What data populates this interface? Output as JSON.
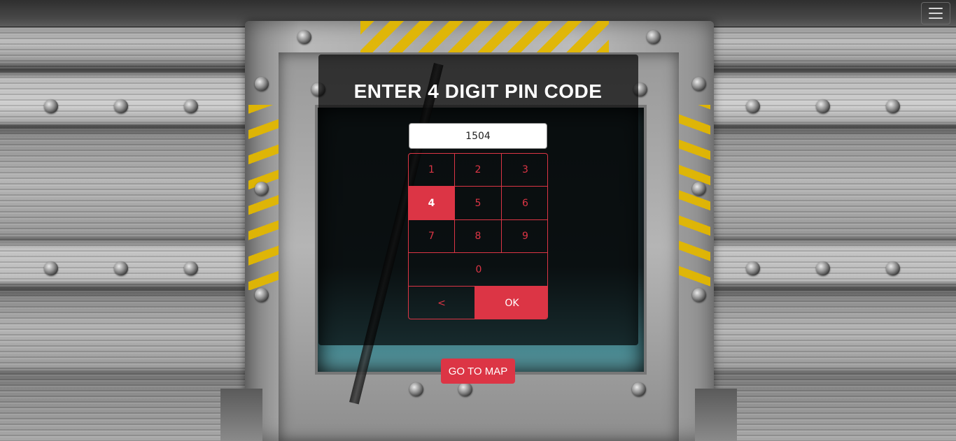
{
  "menu": {
    "icon": "hamburger-menu-icon"
  },
  "pin_dialog": {
    "title": "ENTER 4 DIGIT PIN CODE",
    "input_value": "1504",
    "keys": {
      "k1": "1",
      "k2": "2",
      "k3": "3",
      "k4": "4",
      "k5": "5",
      "k6": "6",
      "k7": "7",
      "k8": "8",
      "k9": "9",
      "k0": "0",
      "backspace": "<",
      "ok": "OK"
    },
    "active_key": "4"
  },
  "go_to_map_label": "GO TO MAP",
  "colors": {
    "accent": "#dc3545",
    "hazard": "#e2b700",
    "panel_bg": "rgba(0,0,0,0.68)"
  }
}
